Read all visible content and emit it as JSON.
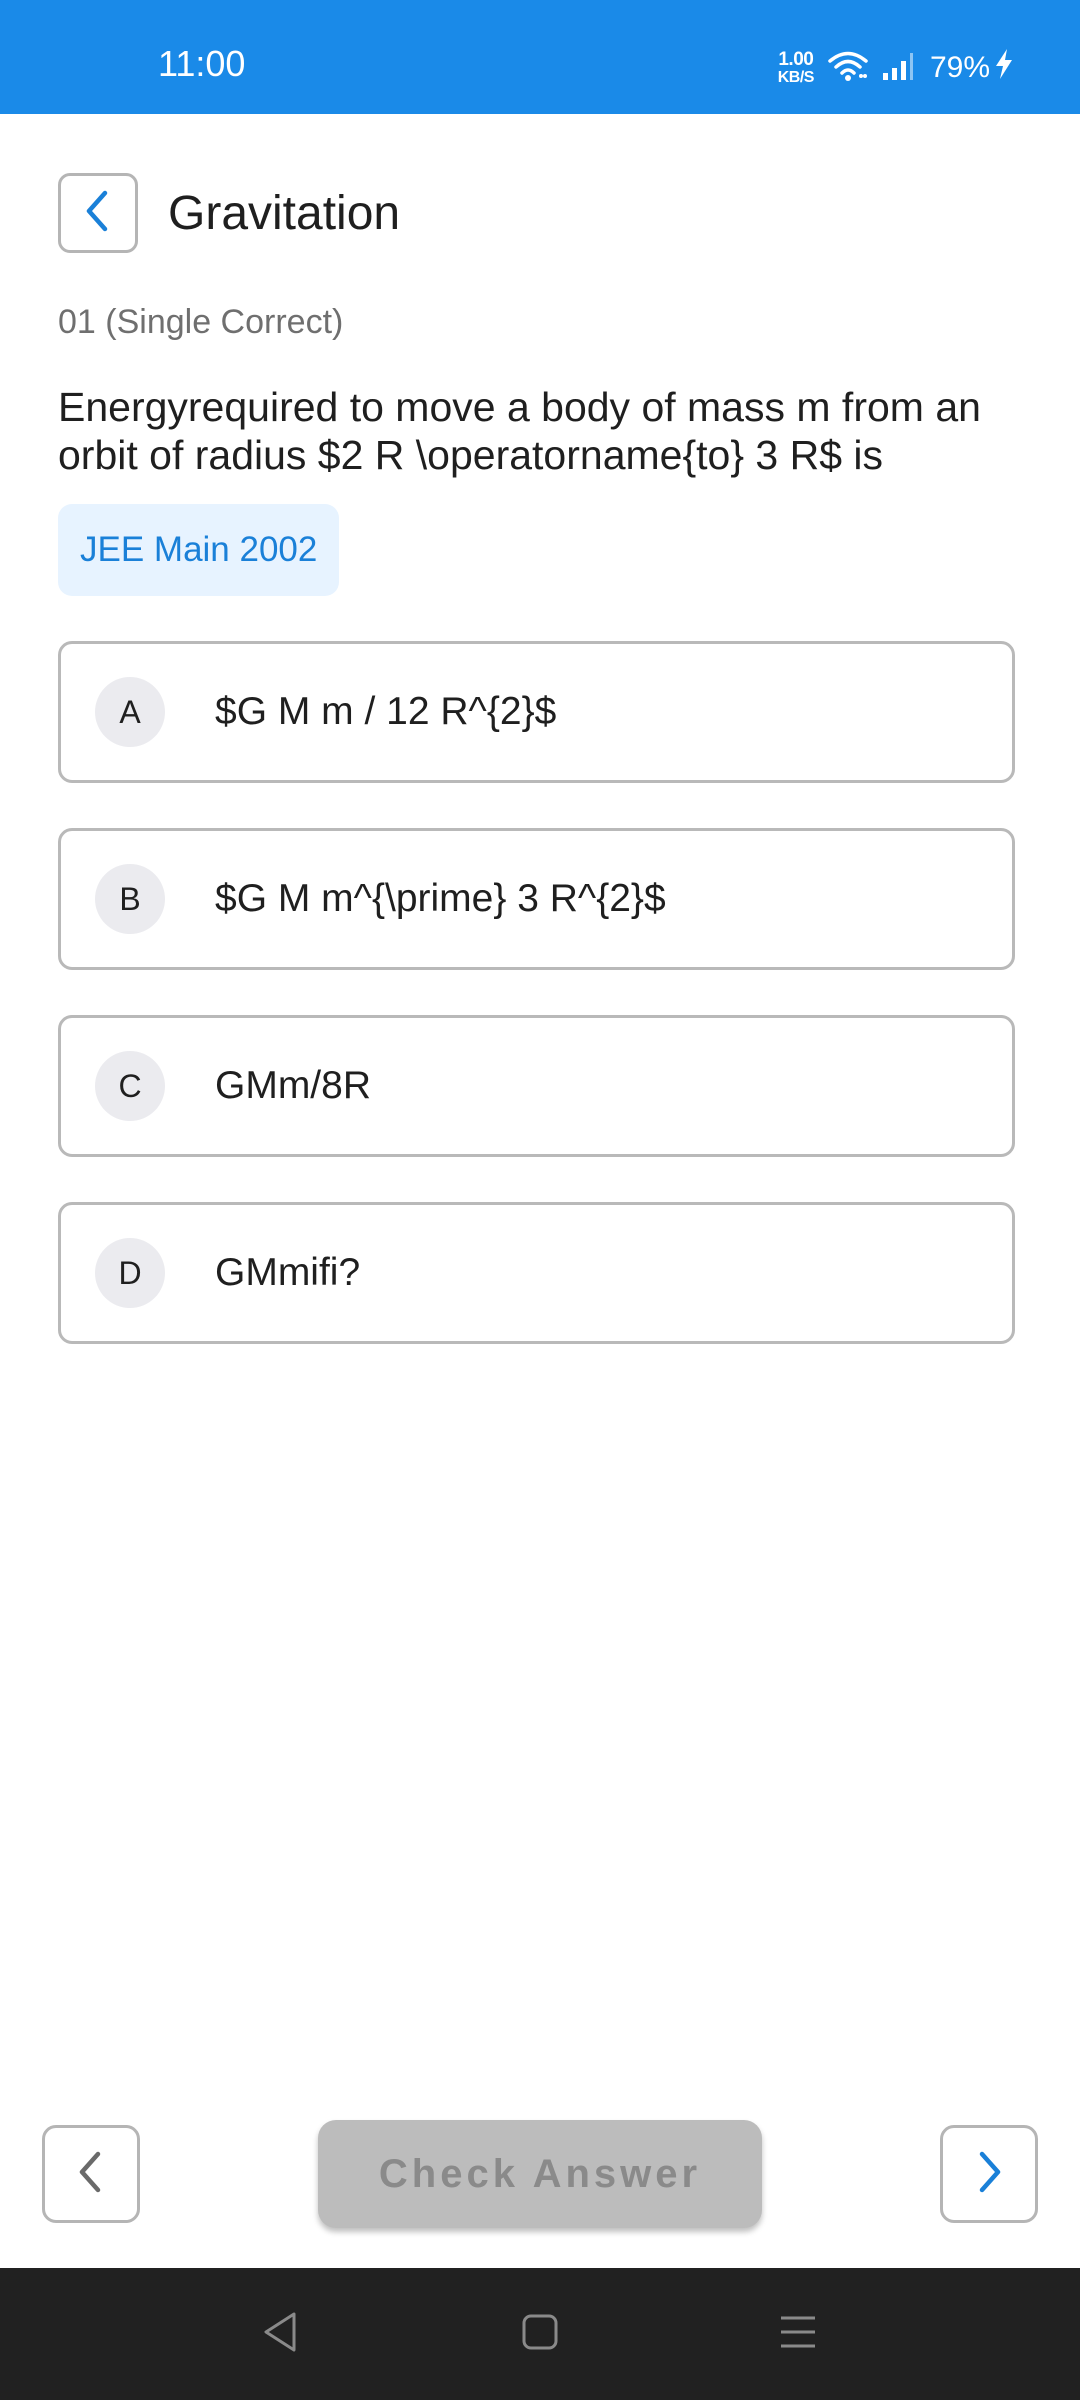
{
  "status_bar": {
    "time": "11:00",
    "net_speed_value": "1.00",
    "net_speed_unit": "KB/S",
    "battery_percent": "79%",
    "icons": [
      "wifi-icon",
      "signal-icon",
      "charging-icon"
    ]
  },
  "header": {
    "title": "Gravitation",
    "back_icon": "chevron-left-icon"
  },
  "question": {
    "meta": "01 (Single Correct)",
    "text": "Energyrequired to move a body of mass m from an orbit of radius $2 R \\operatorname{to} 3 R$ is",
    "tag": "JEE Main 2002"
  },
  "options": [
    {
      "letter": "A",
      "text": "$G M m / 12 R^{2}$"
    },
    {
      "letter": "B",
      "text": "$G M m^{\\prime} 3 R^{2}$"
    },
    {
      "letter": "C",
      "text": "GMm/8R"
    },
    {
      "letter": "D",
      "text": "GMmifi?"
    }
  ],
  "footer": {
    "check_answer_label": "Check Answer",
    "prev_icon": "chevron-left-icon",
    "next_icon": "chevron-right-icon"
  },
  "system_nav": {
    "icons": [
      "triangle-back-icon",
      "square-home-icon",
      "menu-lines-icon"
    ]
  },
  "colors": {
    "accent": "#1a8ae8",
    "tag_bg": "#e7f3ff",
    "tag_text": "#1a80d8",
    "button_disabled": "#bcbcbc",
    "nav_bar": "#212121"
  }
}
